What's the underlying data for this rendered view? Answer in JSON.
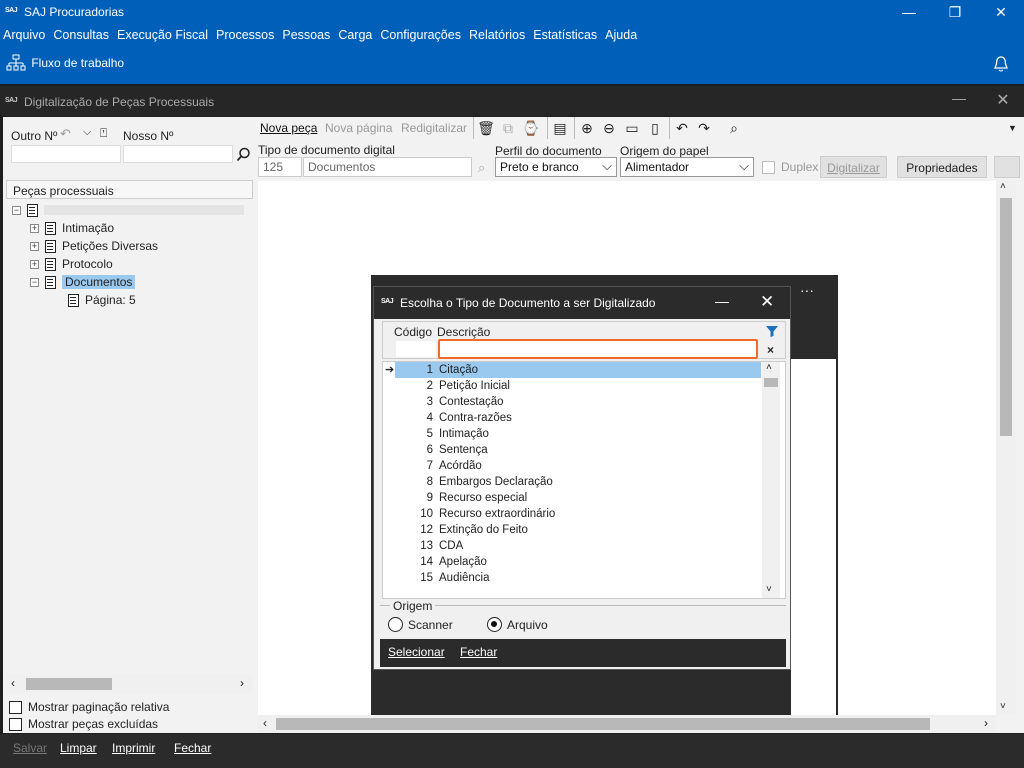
{
  "app": {
    "logo": "SAJ",
    "title": "SAJ Procuradorias"
  },
  "menu": [
    "Arquivo",
    "Consultas",
    "Execução Fiscal",
    "Processos",
    "Pessoas",
    "Carga",
    "Configurações",
    "Relatórios",
    "Estatísticas",
    "Ajuda"
  ],
  "workflow": {
    "label": "Fluxo de trabalho"
  },
  "inner_window": {
    "title": "Digitalização de Peças Processuais"
  },
  "search": {
    "outro_label": "Outro Nº",
    "nosso_label": "Nosso Nº"
  },
  "tree": {
    "header": "Peças processuais",
    "items": [
      "Intimação",
      "Petições Diversas",
      "Protocolo",
      "Documentos"
    ],
    "page_item": "Página: 5"
  },
  "left_options": {
    "relative_paging": "Mostrar paginação relativa",
    "show_deleted": "Mostrar peças excluídas"
  },
  "toolbar": {
    "new_piece": "Nova peça",
    "new_page": "Nova página",
    "rescan": "Redigitalizar"
  },
  "doc_type": {
    "label": "Tipo de documento digital",
    "code": "125",
    "name": "Documentos"
  },
  "profile": {
    "label": "Perfil do documento",
    "value": "Preto e branco"
  },
  "origin_paper": {
    "label": "Origem do papel",
    "value": "Alimentador"
  },
  "duplex_label": "Duplex",
  "digitalizar_label": "Digitalizar",
  "properties_label": "Propriedades",
  "dialog": {
    "title": "Escolha o Tipo de Documento a ser Digitalizado",
    "col_code": "Código",
    "col_desc": "Descrição",
    "rows": [
      {
        "code": "1",
        "desc": "Citação"
      },
      {
        "code": "2",
        "desc": "Petição Inicial"
      },
      {
        "code": "3",
        "desc": "Contestação"
      },
      {
        "code": "4",
        "desc": "Contra-razões"
      },
      {
        "code": "5",
        "desc": "Intimação"
      },
      {
        "code": "6",
        "desc": "Sentença"
      },
      {
        "code": "7",
        "desc": "Acórdão"
      },
      {
        "code": "8",
        "desc": "Embargos Declaração"
      },
      {
        "code": "9",
        "desc": "Recurso especial"
      },
      {
        "code": "10",
        "desc": "Recurso extraordinário"
      },
      {
        "code": "12",
        "desc": "Extinção do Feito"
      },
      {
        "code": "13",
        "desc": "CDA"
      },
      {
        "code": "14",
        "desc": "Apelação"
      },
      {
        "code": "15",
        "desc": "Audiência"
      }
    ],
    "origin_label": "Origem",
    "scanner_label": "Scanner",
    "file_label": "Arquivo",
    "select_btn": "Selecionar",
    "close_btn": "Fechar"
  },
  "bottom": {
    "save": "Salvar",
    "clear": "Limpar",
    "print": "Imprimir",
    "close": "Fechar"
  },
  "colors": {
    "brand": "#005fb8",
    "dark": "#2b2b2b",
    "selection": "#99c9ef",
    "focus": "#f06a2c"
  }
}
